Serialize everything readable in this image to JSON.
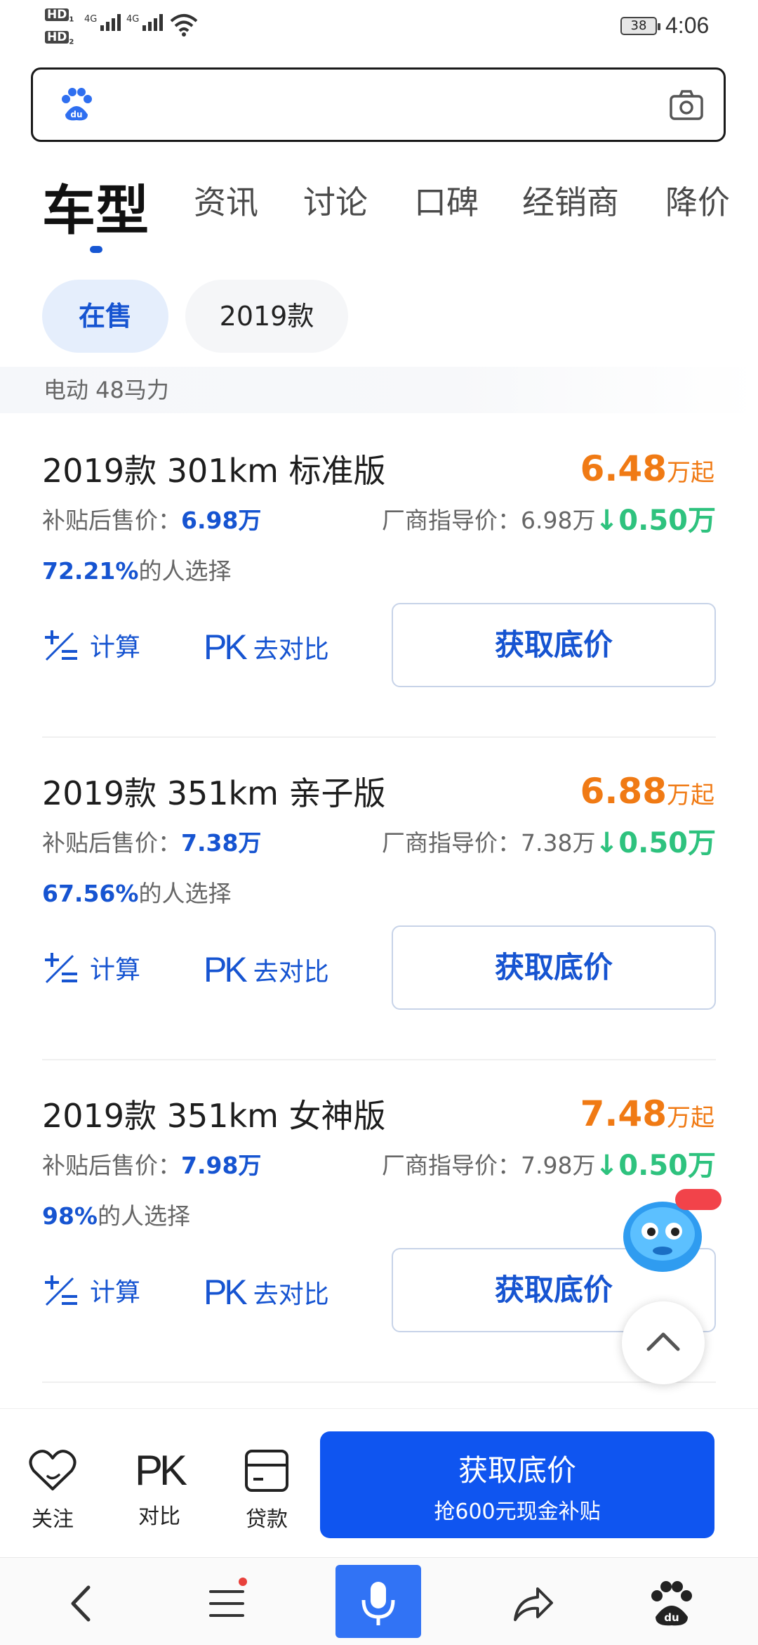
{
  "status_bar": {
    "hd1": "HD",
    "hd2": "HD",
    "net1": "4G",
    "net2": "4G",
    "battery": "38",
    "time": "4:06"
  },
  "search": {
    "placeholder": ""
  },
  "tabs": [
    {
      "label": "车型",
      "active": true
    },
    {
      "label": "资讯"
    },
    {
      "label": "讨论"
    },
    {
      "label": "口碑"
    },
    {
      "label": "经销商"
    },
    {
      "label": "降价"
    }
  ],
  "filters": {
    "on_sale": "在售",
    "year": "2019款"
  },
  "group_header": "电动 48马力",
  "variants": [
    {
      "title": "2019款 301km 标准版",
      "price_num": "6.48",
      "price_unit": "万起",
      "subsidy_label": "补贴后售价：",
      "subsidy_value": "6.98万",
      "msrp": "厂商指导价：6.98万",
      "drop": "↓0.50万",
      "pct": "72.21%",
      "pct_suffix": "的人选择",
      "calc": "计算",
      "compare": "去对比",
      "cta": "获取底价"
    },
    {
      "title": "2019款 351km 亲子版",
      "price_num": "6.88",
      "price_unit": "万起",
      "subsidy_label": "补贴后售价：",
      "subsidy_value": "7.38万",
      "msrp": "厂商指导价：7.38万",
      "drop": "↓0.50万",
      "pct": "67.56%",
      "pct_suffix": "的人选择",
      "calc": "计算",
      "compare": "去对比",
      "cta": "获取底价"
    },
    {
      "title": "2019款 351km 女神版",
      "price_num": "7.48",
      "price_unit": "万起",
      "subsidy_label": "补贴后售价：",
      "subsidy_value": "7.98万",
      "msrp": "厂商指导价：7.98万",
      "drop": "↓0.50万",
      "pct": "98%",
      "pct_suffix": "的人选择",
      "calc": "计算",
      "compare": "去对比",
      "cta": "获取底价"
    }
  ],
  "action_bar": {
    "follow": "关注",
    "compare": "对比",
    "loan": "贷款",
    "primary_l1": "获取底价",
    "primary_l2": "抢600元现金补贴"
  },
  "icons": {
    "search_logo": "baidu-paw-icon",
    "camera": "camera-icon",
    "calc": "calculator-icon",
    "pk": "pk-icon",
    "heart": "heart-icon",
    "card": "card-icon",
    "back": "chevron-left-icon",
    "menu": "menu-icon",
    "mic": "mic-icon",
    "share": "share-icon",
    "home": "baidu-paw-icon",
    "scroll_top": "chevron-up-icon",
    "mascot": "mascot-icon"
  },
  "colors": {
    "primary": "#1654d1",
    "cta": "#0f55f0",
    "price": "#f07a14",
    "drop": "#2ec27e"
  }
}
